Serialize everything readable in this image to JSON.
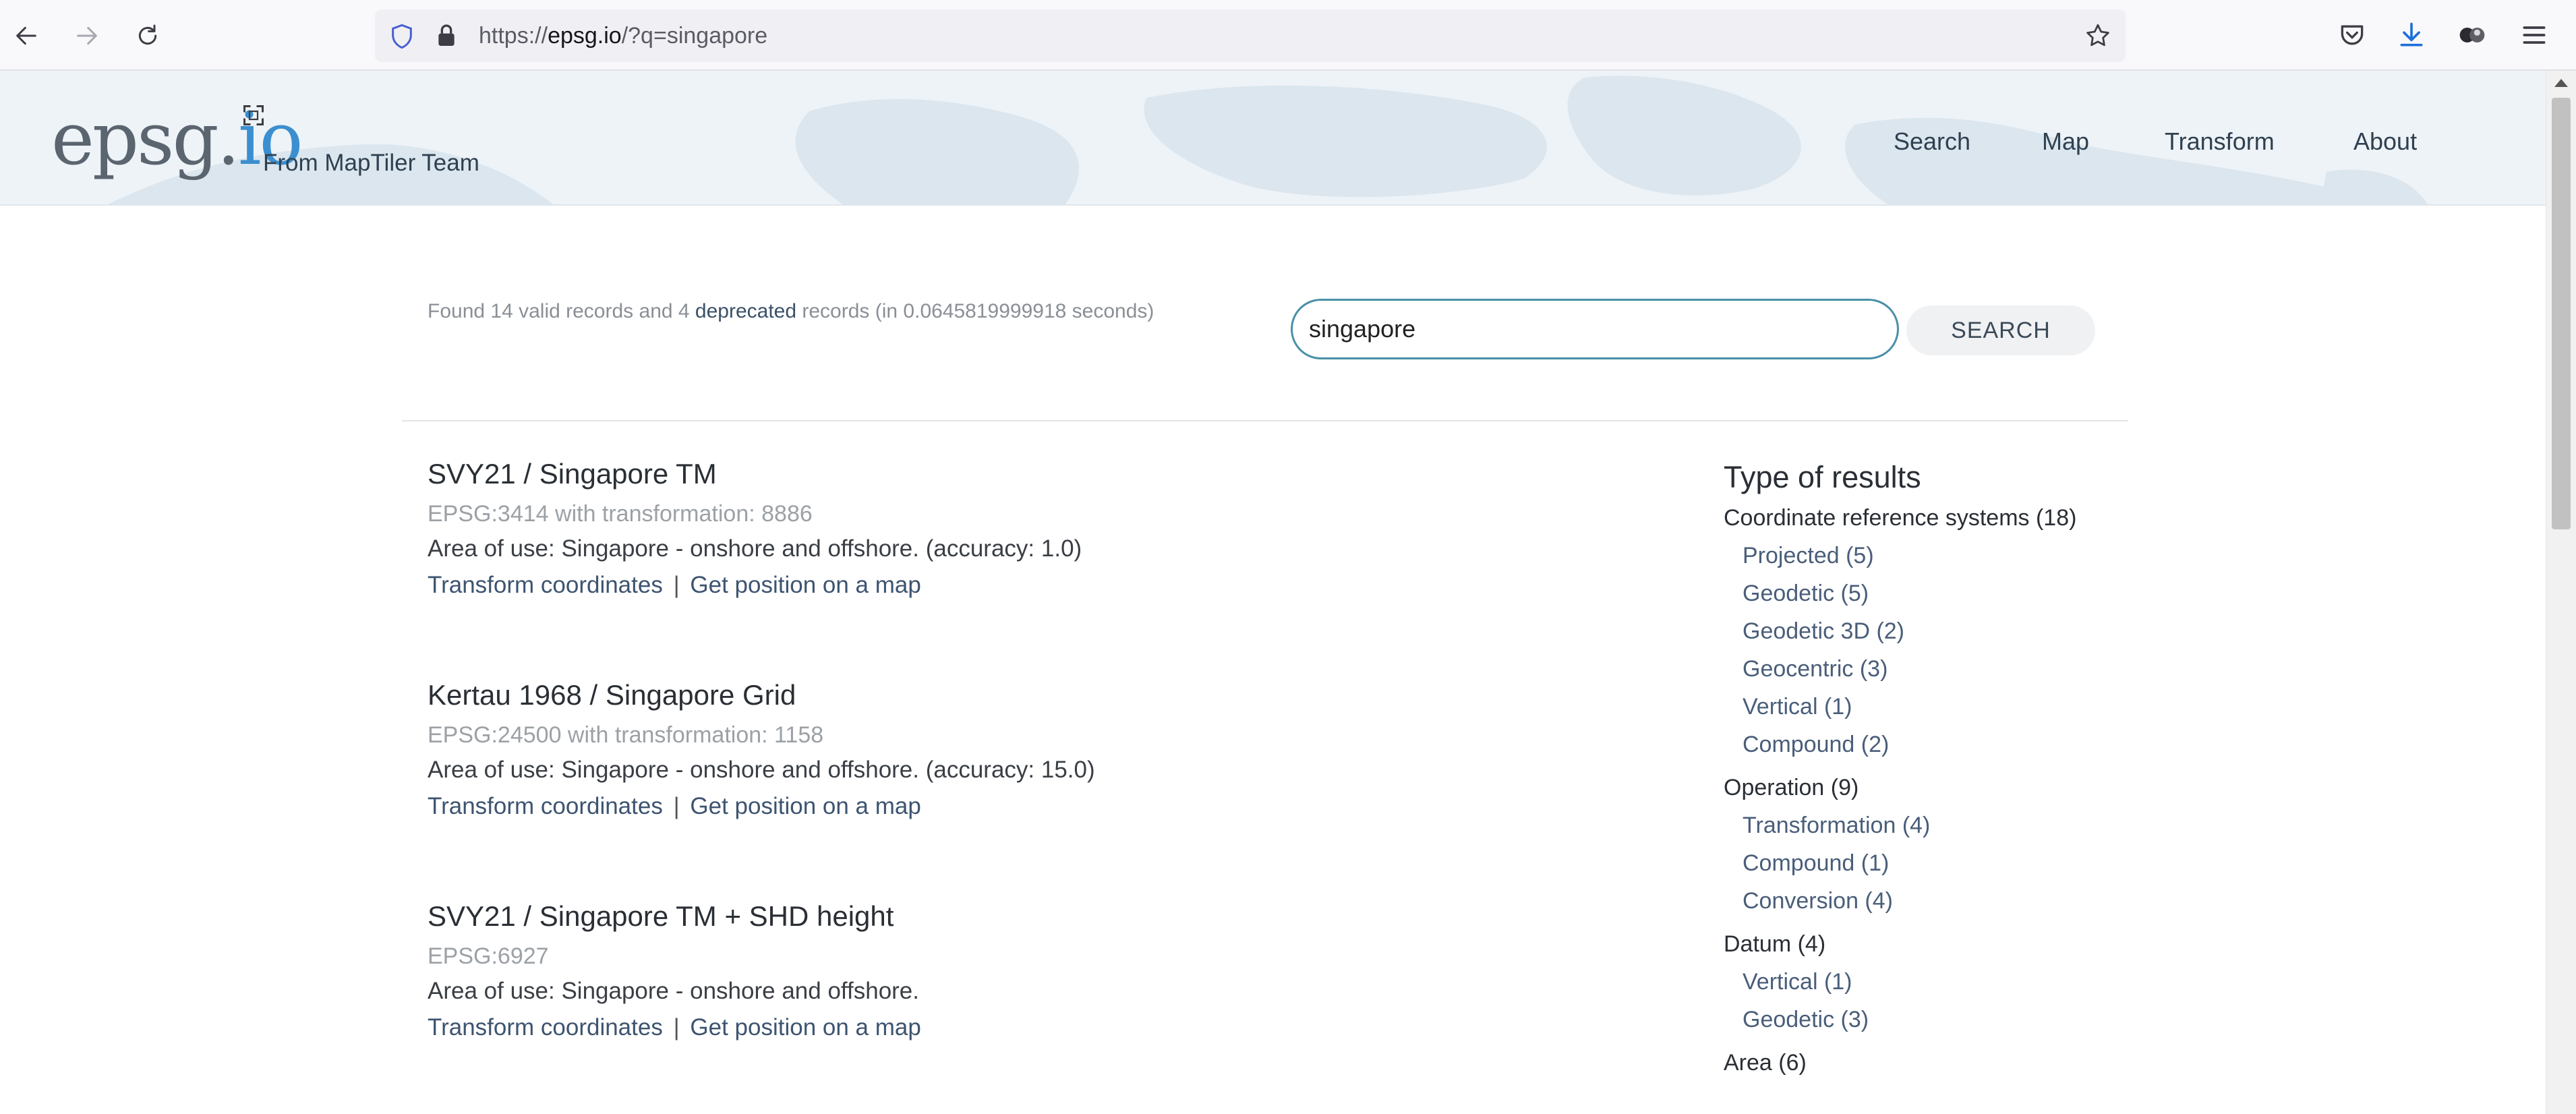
{
  "browser": {
    "url_prefix": "https://",
    "url_domain": "epsg.io",
    "url_path": "/?q=singapore"
  },
  "header": {
    "logo_main": "epsg.",
    "logo_io": "io",
    "tagline": "From MapTiler Team",
    "nav": [
      "Search",
      "Map",
      "Transform",
      "About"
    ]
  },
  "search": {
    "found_prefix": "Found 14 valid records and 4 ",
    "found_deprecated": "deprecated",
    "found_suffix": " records (in 0.0645819999918 seconds)",
    "query": "singapore",
    "button_label": "SEARCH"
  },
  "results": [
    {
      "title": "SVY21 / Singapore TM",
      "code": "EPSG:3414 with transformation: 8886",
      "area": "Area of use: Singapore - onshore and offshore. (accuracy: 1.0)",
      "link_transform": "Transform coordinates",
      "link_separator": "|",
      "link_map": "Get position on a map"
    },
    {
      "title": "Kertau 1968 / Singapore Grid",
      "code": "EPSG:24500 with transformation: 1158",
      "area": "Area of use: Singapore - onshore and offshore. (accuracy: 15.0)",
      "link_transform": "Transform coordinates",
      "link_separator": "|",
      "link_map": "Get position on a map"
    },
    {
      "title": "SVY21 / Singapore TM + SHD height",
      "code": "EPSG:6927",
      "area": "Area of use: Singapore - onshore and offshore.",
      "link_transform": "Transform coordinates",
      "link_separator": "|",
      "link_map": "Get position on a map"
    }
  ],
  "facets": {
    "title": "Type of results",
    "crs": {
      "label": "Coordinate reference systems (18)",
      "items": [
        "Projected (5)",
        "Geodetic (5)",
        "Geodetic 3D (2)",
        "Geocentric (3)",
        "Vertical (1)",
        "Compound (2)"
      ]
    },
    "operation": {
      "label": "Operation (9)",
      "items": [
        "Transformation (4)",
        "Compound (1)",
        "Conversion (4)"
      ]
    },
    "datum": {
      "label": "Datum (4)",
      "items": [
        "Vertical (1)",
        "Geodetic (3)"
      ]
    },
    "area": {
      "label": "Area (6)"
    }
  }
}
